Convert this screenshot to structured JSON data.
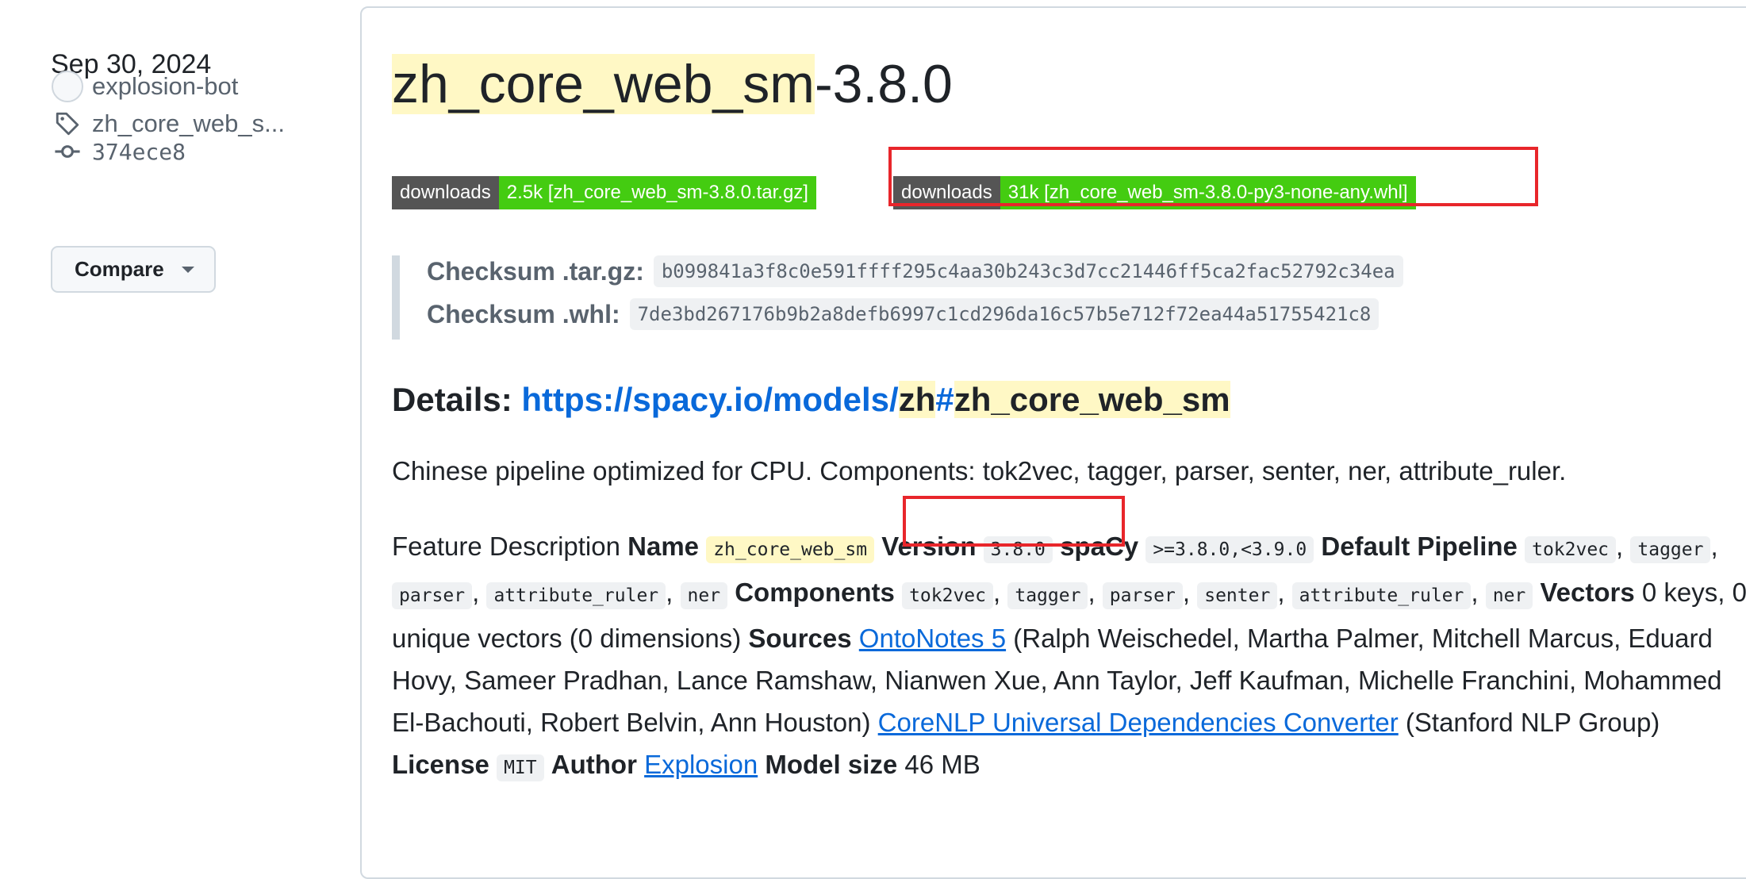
{
  "sidebar": {
    "date": "Sep 30, 2024",
    "author": "explosion-bot",
    "tag": "zh_core_web_s...",
    "commit": "374ece8",
    "compare_label": "Compare"
  },
  "release": {
    "title_highlight": "zh_core_web_sm",
    "title_rest": "-3.8.0",
    "badges": [
      {
        "label": "downloads",
        "value": "2.5k [zh_core_web_sm-3.8.0.tar.gz]"
      },
      {
        "label": "downloads",
        "value": "31k [zh_core_web_sm-3.8.0-py3-none-any.whl]"
      }
    ],
    "checksums": [
      {
        "label": "Checksum .tar.gz:",
        "value": "b099841a3f8c0e591ffff295c4aa30b243c3d7cc21446ff5ca2fac52792c34ea"
      },
      {
        "label": "Checksum .whl:",
        "value": "7de3bd267176b9b2a8defb6997c1cd296da16c57b5e712f72ea44a51755421c8"
      }
    ],
    "details": {
      "prefix": "Details:",
      "link_base": "https://spacy.io/models/",
      "link_lang": "zh",
      "link_hash": "#",
      "link_model": "zh_core_web_sm"
    },
    "description": "Chinese pipeline optimized for CPU. Components: tok2vec, tagger, parser, senter, ner, attribute_ruler.",
    "features": {
      "intro": "Feature Description",
      "name_label": "Name",
      "name_value": "zh_core_web_sm",
      "version_label": "Version",
      "version_value": "3.8.0",
      "spacy_label": "spaCy",
      "spacy_value": ">=3.8.0,<3.9.0",
      "pipeline_label": "Default Pipeline",
      "pipeline": [
        "tok2vec",
        "tagger",
        "parser",
        "attribute_ruler",
        "ner"
      ],
      "components_label": "Components",
      "components": [
        "tok2vec",
        "tagger",
        "parser",
        "senter",
        "attribute_ruler",
        "ner"
      ],
      "vectors_label": "Vectors",
      "vectors_value": "0 keys, 0 unique vectors (0 dimensions)",
      "sources_label": "Sources",
      "source1_link": "OntoNotes 5",
      "source1_text": "(Ralph Weischedel, Martha Palmer, Mitchell Marcus, Eduard Hovy, Sameer Pradhan, Lance Ramshaw, Nianwen Xue, Ann Taylor, Jeff Kaufman, Michelle Franchini, Mohammed El-Bachouti, Robert Belvin, Ann Houston)",
      "source2_link": "CoreNLP Universal Dependencies Converter",
      "source2_text": "(Stanford NLP Group)",
      "license_label": "License",
      "license_value": "MIT",
      "author_label": "Author",
      "author_link": "Explosion",
      "size_label": "Model size",
      "size_value": "46 MB"
    }
  }
}
